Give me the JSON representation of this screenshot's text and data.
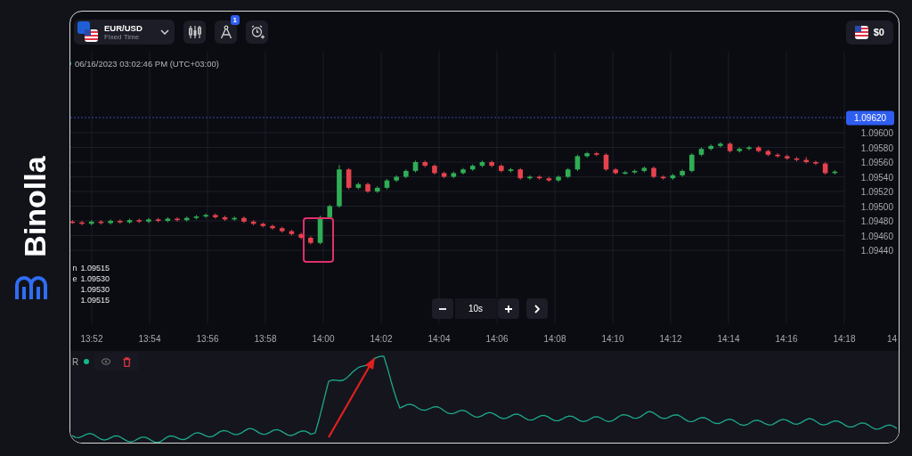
{
  "brand": {
    "name": "Binolla"
  },
  "instrument": {
    "symbol": "EUR/USD",
    "mode": "Fixed Time"
  },
  "toolbar": [
    {
      "kind": "indicators"
    },
    {
      "kind": "drawings",
      "badge": "1"
    },
    {
      "kind": "alert"
    }
  ],
  "balance": {
    "amount": "$0"
  },
  "chart": {
    "timestamp": "06/16/2023 03:02:46 PM (UTC+03:00)",
    "current_price": "1.09620",
    "time_axis": [
      "13:52",
      "13:54",
      "13:56",
      "13:58",
      "14:00",
      "14:02",
      "14:04",
      "14:06",
      "14:08",
      "14:10",
      "14:12",
      "14:14",
      "14:16",
      "14:18",
      "14"
    ],
    "legend": [
      {
        "label": "n",
        "value": "1.09515"
      },
      {
        "label": "e",
        "value": "1.09530"
      },
      {
        "value": "1.09530"
      },
      {
        "value": "1.09515"
      }
    ],
    "chart_data": {
      "type": "candlestick",
      "ylim": [
        1.0934,
        1.0971
      ],
      "grid": true,
      "yticks": [
        {
          "value": 1.096,
          "label": "1.09600"
        },
        {
          "value": 1.0958,
          "label": "1.09580"
        },
        {
          "value": 1.0956,
          "label": "1.09560"
        },
        {
          "value": 1.0954,
          "label": "1.09540"
        },
        {
          "value": 1.0952,
          "label": "1.09520"
        },
        {
          "value": 1.095,
          "label": "1.09500"
        },
        {
          "value": 1.0948,
          "label": "1.09480"
        },
        {
          "value": 1.0946,
          "label": "1.09460"
        },
        {
          "value": 1.0944,
          "label": "1.09440"
        }
      ],
      "ohlc": [
        [
          1.09479,
          1.09481,
          1.09476,
          1.09478
        ],
        [
          1.09478,
          1.0948,
          1.09474,
          1.09476
        ],
        [
          1.09476,
          1.09481,
          1.09474,
          1.09479
        ],
        [
          1.09479,
          1.09481,
          1.09475,
          1.09477
        ],
        [
          1.09477,
          1.09482,
          1.09475,
          1.0948
        ],
        [
          1.0948,
          1.09482,
          1.09476,
          1.09478
        ],
        [
          1.09478,
          1.09483,
          1.09476,
          1.09481
        ],
        [
          1.09481,
          1.09483,
          1.09477,
          1.09479
        ],
        [
          1.09479,
          1.09484,
          1.09477,
          1.09482
        ],
        [
          1.09482,
          1.09484,
          1.09478,
          1.0948
        ],
        [
          1.0948,
          1.09485,
          1.09478,
          1.09483
        ],
        [
          1.09483,
          1.09485,
          1.09479,
          1.09481
        ],
        [
          1.09481,
          1.09486,
          1.09479,
          1.09484
        ],
        [
          1.09484,
          1.09488,
          1.09482,
          1.09486
        ],
        [
          1.09486,
          1.0949,
          1.09484,
          1.09488
        ],
        [
          1.09488,
          1.0949,
          1.09483,
          1.09485
        ],
        [
          1.09485,
          1.09487,
          1.0948,
          1.09482
        ],
        [
          1.09482,
          1.09486,
          1.0948,
          1.09484
        ],
        [
          1.09484,
          1.09486,
          1.09477,
          1.09479
        ],
        [
          1.09479,
          1.09481,
          1.09474,
          1.09476
        ],
        [
          1.09476,
          1.09478,
          1.09471,
          1.09473
        ],
        [
          1.09473,
          1.09475,
          1.09468,
          1.0947
        ],
        [
          1.0947,
          1.09472,
          1.09464,
          1.09466
        ],
        [
          1.09466,
          1.09468,
          1.0946,
          1.09462
        ],
        [
          1.09462,
          1.09464,
          1.09455,
          1.09457
        ],
        [
          1.09457,
          1.09459,
          1.09448,
          1.0945
        ],
        [
          1.0945,
          1.09487,
          1.09448,
          1.09485
        ],
        [
          1.09485,
          1.09502,
          1.09483,
          1.095
        ],
        [
          1.095,
          1.09556,
          1.09498,
          1.0955
        ],
        [
          1.0955,
          1.09552,
          1.09523,
          1.09525
        ],
        [
          1.09525,
          1.09532,
          1.09523,
          1.0953
        ],
        [
          1.0953,
          1.09532,
          1.09518,
          1.0952
        ],
        [
          1.0952,
          1.09527,
          1.09518,
          1.09525
        ],
        [
          1.09525,
          1.09537,
          1.09523,
          1.09535
        ],
        [
          1.09535,
          1.09542,
          1.09533,
          1.0954
        ],
        [
          1.0954,
          1.0955,
          1.09538,
          1.09548
        ],
        [
          1.09548,
          1.09562,
          1.09546,
          1.0956
        ],
        [
          1.0956,
          1.09562,
          1.09553,
          1.09555
        ],
        [
          1.09555,
          1.09557,
          1.09543,
          1.09545
        ],
        [
          1.09545,
          1.09547,
          1.09538,
          1.0954
        ],
        [
          1.0954,
          1.09547,
          1.09538,
          1.09545
        ],
        [
          1.09545,
          1.09552,
          1.09543,
          1.0955
        ],
        [
          1.0955,
          1.09557,
          1.09548,
          1.09555
        ],
        [
          1.09555,
          1.09562,
          1.09553,
          1.0956
        ],
        [
          1.0956,
          1.09562,
          1.09553,
          1.09555
        ],
        [
          1.09555,
          1.09557,
          1.09546,
          1.09548
        ],
        [
          1.09548,
          1.09552,
          1.09546,
          1.0955
        ],
        [
          1.0955,
          1.09552,
          1.09536,
          1.09538
        ],
        [
          1.09538,
          1.09542,
          1.09536,
          1.0954
        ],
        [
          1.0954,
          1.09542,
          1.09536,
          1.09538
        ],
        [
          1.09538,
          1.0954,
          1.09533,
          1.09535
        ],
        [
          1.09535,
          1.09542,
          1.09533,
          1.0954
        ],
        [
          1.0954,
          1.09552,
          1.09538,
          1.0955
        ],
        [
          1.0955,
          1.0957,
          1.09548,
          1.09568
        ],
        [
          1.09568,
          1.09574,
          1.09566,
          1.09572
        ],
        [
          1.09572,
          1.09574,
          1.09568,
          1.0957
        ],
        [
          1.0957,
          1.09572,
          1.09548,
          1.0955
        ],
        [
          1.0955,
          1.09552,
          1.09543,
          1.09545
        ],
        [
          1.09545,
          1.09548,
          1.09543,
          1.09546
        ],
        [
          1.09546,
          1.0955,
          1.09544,
          1.09548
        ],
        [
          1.09548,
          1.09554,
          1.09546,
          1.09552
        ],
        [
          1.09552,
          1.09554,
          1.09538,
          1.0954
        ],
        [
          1.0954,
          1.09542,
          1.09536,
          1.09538
        ],
        [
          1.09538,
          1.09544,
          1.09536,
          1.09542
        ],
        [
          1.09542,
          1.0955,
          1.0954,
          1.09548
        ],
        [
          1.09548,
          1.09572,
          1.09546,
          1.0957
        ],
        [
          1.0957,
          1.0958,
          1.09568,
          1.09578
        ],
        [
          1.09578,
          1.09584,
          1.09576,
          1.09582
        ],
        [
          1.09582,
          1.09587,
          1.0958,
          1.09585
        ],
        [
          1.09585,
          1.09587,
          1.09573,
          1.09575
        ],
        [
          1.09575,
          1.0958,
          1.09573,
          1.09578
        ],
        [
          1.09578,
          1.09582,
          1.09576,
          1.0958
        ],
        [
          1.0958,
          1.09582,
          1.09573,
          1.09575
        ],
        [
          1.09575,
          1.09577,
          1.09568,
          1.0957
        ],
        [
          1.0957,
          1.09572,
          1.09566,
          1.09568
        ],
        [
          1.09568,
          1.0957,
          1.09563,
          1.09565
        ],
        [
          1.09565,
          1.09567,
          1.09561,
          1.09563
        ],
        [
          1.09563,
          1.09567,
          1.09558,
          1.0956
        ],
        [
          1.0956,
          1.09562,
          1.09556,
          1.09558
        ],
        [
          1.09558,
          1.0956,
          1.09543,
          1.09545
        ],
        [
          1.09545,
          1.09549,
          1.09543,
          1.09547
        ]
      ]
    }
  },
  "zoom": {
    "interval": "10s"
  },
  "indicator": {
    "label": "R"
  }
}
